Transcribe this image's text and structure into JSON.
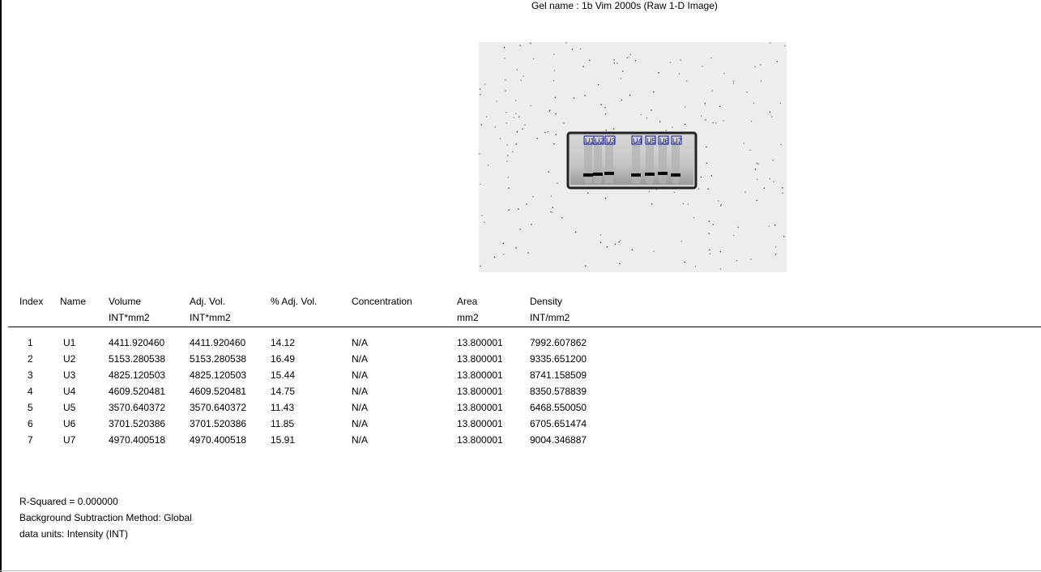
{
  "gel_name": "Gel name : 1b Vim 2000s (Raw 1-D Image)",
  "lane_labels": [
    "U1",
    "U2",
    "U3",
    "U4",
    "U5",
    "U6",
    "U7"
  ],
  "table": {
    "columns": [
      {
        "label": "Index",
        "unit": ""
      },
      {
        "label": "Name",
        "unit": ""
      },
      {
        "label": "Volume",
        "unit": "INT*mm2"
      },
      {
        "label": "Adj. Vol.",
        "unit": "INT*mm2"
      },
      {
        "label": "% Adj. Vol.",
        "unit": ""
      },
      {
        "label": "Concentration",
        "unit": ""
      },
      {
        "label": "Area",
        "unit": "mm2"
      },
      {
        "label": "Density",
        "unit": "INT/mm2"
      }
    ],
    "rows": [
      [
        "1",
        "U1",
        "4411.920460",
        "4411.920460",
        "14.12",
        "N/A",
        "13.800001",
        "7992.607862"
      ],
      [
        "2",
        "U2",
        "5153.280538",
        "5153.280538",
        "16.49",
        "N/A",
        "13.800001",
        "9335.651200"
      ],
      [
        "3",
        "U3",
        "4825.120503",
        "4825.120503",
        "15.44",
        "N/A",
        "13.800001",
        "8741.158509"
      ],
      [
        "4",
        "U4",
        "4609.520481",
        "4609.520481",
        "14.75",
        "N/A",
        "13.800001",
        "8350.578839"
      ],
      [
        "5",
        "U5",
        "3570.640372",
        "3570.640372",
        "11.43",
        "N/A",
        "13.800001",
        "6468.550050"
      ],
      [
        "6",
        "U6",
        "3701.520386",
        "3701.520386",
        "11.85",
        "N/A",
        "13.800001",
        "6705.651474"
      ],
      [
        "7",
        "U7",
        "4970.400518",
        "4970.400518",
        "15.91",
        "N/A",
        "13.800001",
        "9004.346887"
      ]
    ]
  },
  "footer": {
    "r_squared": "R-Squared = 0.000000",
    "background_method": "Background Subtraction Method:  Global",
    "data_units": "data units: Intensity  (INT)"
  },
  "colors": {
    "lane_box": "#1a1a9a",
    "gel_background": "#ececec",
    "band": "#0a0a0a"
  }
}
